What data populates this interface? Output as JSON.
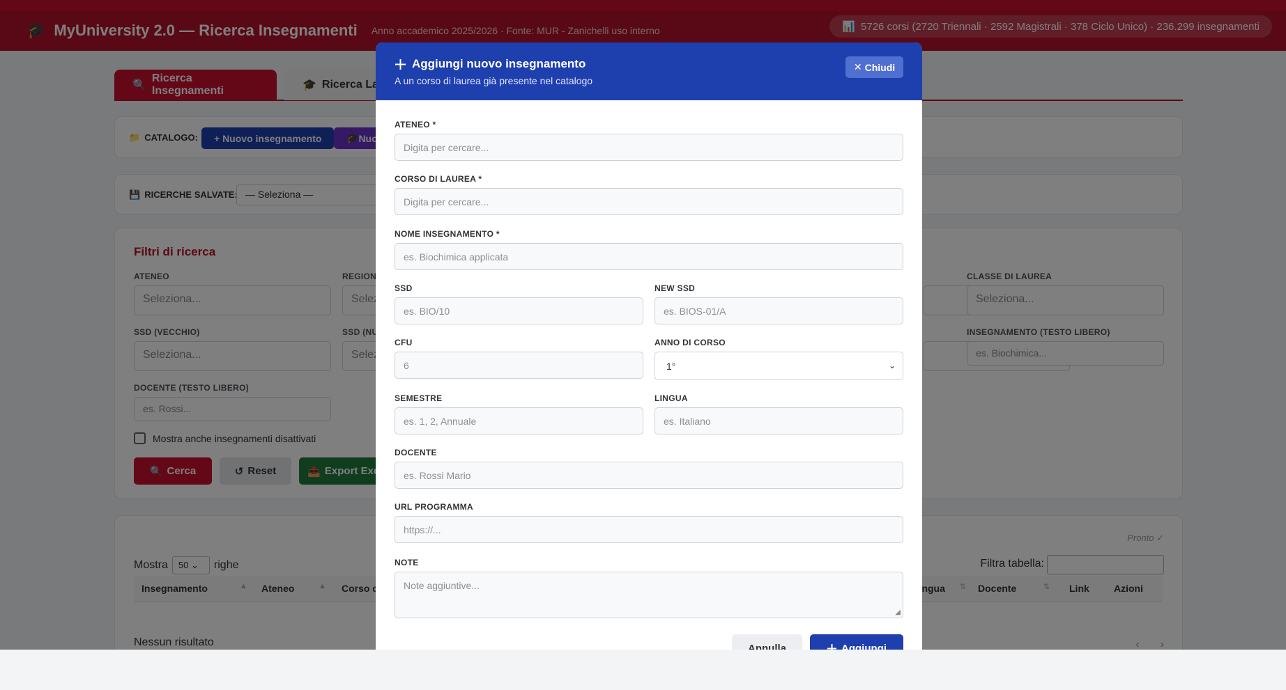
{
  "header": {
    "title": "MyUniversity 2.0 — Ricerca Insegnamenti",
    "subtitle": "Anno accademico 2025/2026 · Fonte: MUR - Zanichelli uso interno",
    "stats": "5726 corsi (2720 Triennali · 2592 Magistrali · 378 Ciclo Unico) · 236.299 insegnamenti"
  },
  "tabs": [
    {
      "label": "Ricerca Insegnamenti",
      "icon": "search-icon"
    },
    {
      "label": "Ricerca Lauree",
      "icon": "graduation-cap-icon"
    }
  ],
  "catalog": {
    "label": "CATALOGO:",
    "new_teaching": "+ Nuovo insegnamento",
    "new_course": "Nuovo corso"
  },
  "saved": {
    "label": "RICERCHE SALVATE:",
    "selected": "— Seleziona —"
  },
  "filters": {
    "title": "Filtri di ricerca",
    "ateneo_label": "ATENEO",
    "ateneo_placeholder": "Seleziona...",
    "regione_label": "REGIONE",
    "regione_placeholder": "Seleziona...",
    "classe_label": "CLASSE DI LAUREA",
    "classe_placeholder": "Seleziona...",
    "ssd_old_label": "SSD (VECCHIO)",
    "ssd_old_placeholder": "Seleziona...",
    "ssd_new_label": "SSD (NUOVO)",
    "ssd_new_placeholder": "Seleziona...",
    "insegnamento_label": "INSEGNAMENTO (TESTO LIBERO)",
    "insegnamento_placeholder": "es. Biochimica...",
    "docente_label": "DOCENTE (TESTO LIBERO)",
    "docente_placeholder": "es. Rossi...",
    "show_disabled": "Mostra anche insegnamenti disattivati",
    "search_btn": "Cerca",
    "reset_btn": "Reset",
    "export_btn": "Export Excel"
  },
  "results": {
    "show_prefix": "Mostra",
    "page_size": "50",
    "show_suffix": "righe",
    "status": "Pronto ✓",
    "filter_label": "Filtra tabella:",
    "columns": [
      "Insegnamento",
      "Ateneo",
      "Corso di laurea",
      "Lingua",
      "Docente",
      "Link",
      "Azioni"
    ],
    "empty": "Nessun risultato",
    "prev": "‹",
    "next": "›"
  },
  "modal": {
    "title": "Aggiungi nuovo insegnamento",
    "subtitle": "A un corso di laurea già presente nel catalogo",
    "close": "Chiudi",
    "ateneo_label": "ATENEO *",
    "ateneo_placeholder": "Digita per cercare...",
    "corso_label": "CORSO DI LAUREA *",
    "corso_placeholder": "Digita per cercare...",
    "nome_label": "NOME INSEGNAMENTO *",
    "nome_placeholder": "es. Biochimica applicata",
    "ssd_label": "SSD",
    "ssd_placeholder": "es. BIO/10",
    "new_ssd_label": "NEW SSD",
    "new_ssd_placeholder": "es. BIOS-01/A",
    "cfu_label": "CFU",
    "cfu_placeholder": "6",
    "anno_label": "ANNO DI CORSO",
    "anno_value": "1°",
    "semestre_label": "SEMESTRE",
    "semestre_placeholder": "es. 1, 2, Annuale",
    "lingua_label": "LINGUA",
    "lingua_placeholder": "es. Italiano",
    "docente_label": "DOCENTE",
    "docente_placeholder": "es. Rossi Mario",
    "url_label": "URL PROGRAMMA",
    "url_placeholder": "https://...",
    "note_label": "NOTE",
    "note_placeholder": "Note aggiuntive...",
    "cancel": "Annulla",
    "submit": "Aggiungi"
  },
  "colors": {
    "brand_red": "#c8102e",
    "modal_blue": "#1e3fae",
    "purple": "#6d32c9",
    "green": "#1e7a3c"
  }
}
